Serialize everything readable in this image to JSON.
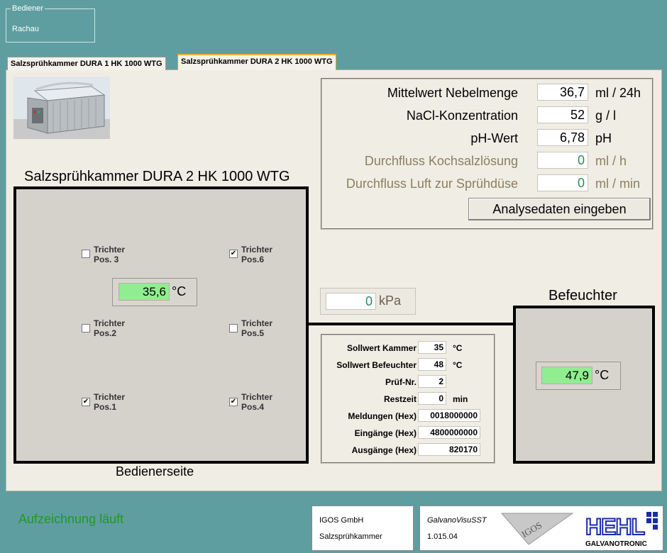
{
  "operator": {
    "legend": "Bediener",
    "name": "Rachau"
  },
  "tabs": [
    {
      "label": "Salzsprühkammer DURA 1 HK 1000 WTG"
    },
    {
      "label": "Salzsprühkammer DURA 2 HK 1000 WTG"
    }
  ],
  "chamber": {
    "title": "Salzsprühkammer DURA 2 HK 1000 WTG",
    "side_label": "Bedienerseite",
    "temperature": {
      "value": "35,6",
      "unit": "°C"
    },
    "funnels": [
      {
        "line1": "Trichter",
        "line2": "Pos. 3",
        "checked": false
      },
      {
        "line1": "Trichter",
        "line2": "Pos.6",
        "checked": true
      },
      {
        "line1": "Trichter",
        "line2": "Pos.2",
        "checked": false
      },
      {
        "line1": "Trichter",
        "line2": "Pos.5",
        "checked": false
      },
      {
        "line1": "Trichter",
        "line2": "Pos.1",
        "checked": true
      },
      {
        "line1": "Trichter",
        "line2": "Pos.4",
        "checked": true
      }
    ]
  },
  "analysis": {
    "rows": [
      {
        "label": "Mittelwert Nebelmenge",
        "value": "36,7",
        "unit": "ml / 24h"
      },
      {
        "label": "NaCl-Konzentration",
        "value": "52",
        "unit": "g / l"
      },
      {
        "label": "pH-Wert",
        "value": "6,78",
        "unit": "pH"
      },
      {
        "label": "Durchfluss Kochsalzlösung",
        "value": "0",
        "unit": "ml / h"
      },
      {
        "label": "Durchfluss Luft zur Sprühdüse",
        "value": "0",
        "unit": "ml / min"
      }
    ],
    "button_label": "Analysedaten eingeben"
  },
  "pressure": {
    "value": "0",
    "unit": "kPa"
  },
  "humidifier": {
    "title": "Befeuchter",
    "temperature": {
      "value": "47,9",
      "unit": "°C"
    }
  },
  "status": {
    "rows": [
      {
        "label": "Sollwert Kammer",
        "value": "35",
        "unit": "°C"
      },
      {
        "label": "Sollwert Befeuchter",
        "value": "48",
        "unit": "°C"
      },
      {
        "label": "Prüf-Nr.",
        "value": "2",
        "unit": ""
      },
      {
        "label": "Restzeit",
        "value": "0",
        "unit": "min"
      },
      {
        "label": "Meldungen (Hex)",
        "value": "0018000000",
        "unit": ""
      },
      {
        "label": "Eingänge (Hex)",
        "value": "4800000000",
        "unit": ""
      },
      {
        "label": "Ausgänge (Hex)",
        "value": "820170",
        "unit": ""
      }
    ]
  },
  "footer": {
    "recording_status": "Aufzeichnung läuft",
    "company": "IGOS GmbH",
    "product": "Salzsprühkammer",
    "software": "GalvanoVisuSST",
    "version": "1.015.04",
    "igos_logo_text": "IGOS",
    "hehl_logo_text": "HEHL",
    "hehl_subtext": "GALVANOTRONIC"
  },
  "colors": {
    "background": "#5f9ea0",
    "panel": "#f0ede4",
    "temp_green": "#90ee90",
    "recording_green": "#1f9a1f"
  }
}
